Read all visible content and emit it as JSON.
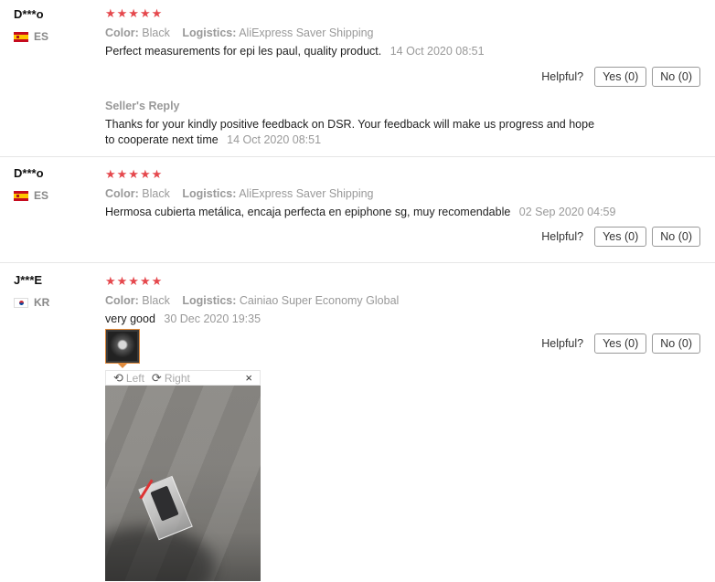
{
  "helpful_label": "Helpful?",
  "reviews": [
    {
      "user": "D***o",
      "country": "ES",
      "stars": "★★★★★",
      "color_label": "Color:",
      "color": "Black",
      "logistics_label": "Logistics:",
      "logistics": "AliExpress Saver Shipping",
      "text": "Perfect measurements for epi les paul, quality product.",
      "date": "14 Oct 2020 08:51",
      "yes": "Yes (0)",
      "no": "No (0)",
      "reply": {
        "title": "Seller's Reply",
        "text": "Thanks for your kindly positive feedback on DSR. Your feedback will make us progress and hope to cooperate next time",
        "date": "14 Oct 2020 08:51"
      }
    },
    {
      "user": "D***o",
      "country": "ES",
      "stars": "★★★★★",
      "color_label": "Color:",
      "color": "Black",
      "logistics_label": "Logistics:",
      "logistics": "AliExpress Saver Shipping",
      "text": "Hermosa cubierta metálica, encaja perfecta en epiphone sg, muy recomendable",
      "date": "02 Sep 2020 04:59",
      "yes": "Yes (0)",
      "no": "No (0)"
    },
    {
      "user": "J***E",
      "country": "KR",
      "stars": "★★★★★",
      "color_label": "Color:",
      "color": "Black",
      "logistics_label": "Logistics:",
      "logistics": "Cainiao Super Economy Global",
      "text": "very good",
      "date": "30 Dec 2020 19:35",
      "yes": "Yes (0)",
      "no": "No (0)"
    }
  ],
  "viewer": {
    "left_label": "Left",
    "right_label": "Right",
    "close_glyph": "×",
    "rotate_left_glyph": "⟲",
    "rotate_right_glyph": "⟳"
  }
}
